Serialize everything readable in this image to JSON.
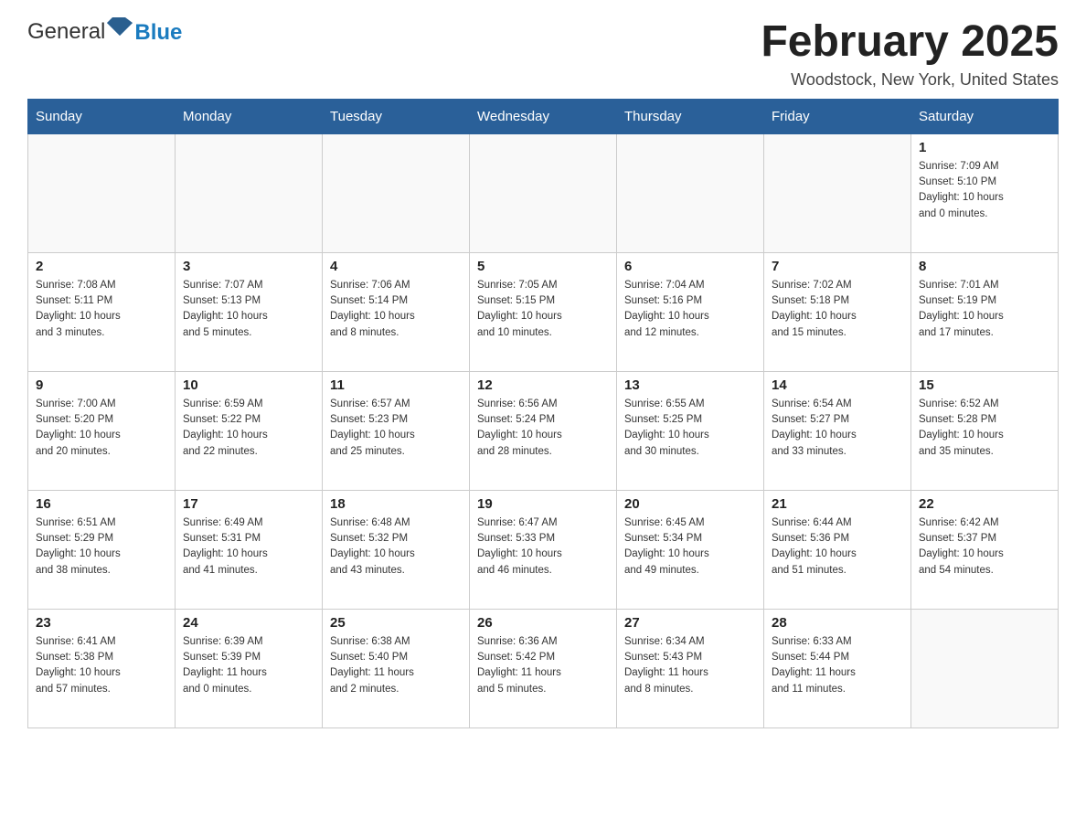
{
  "header": {
    "logo_general": "General",
    "logo_blue": "Blue",
    "month_title": "February 2025",
    "location": "Woodstock, New York, United States"
  },
  "weekdays": [
    "Sunday",
    "Monday",
    "Tuesday",
    "Wednesday",
    "Thursday",
    "Friday",
    "Saturday"
  ],
  "weeks": [
    [
      {
        "day": "",
        "info": ""
      },
      {
        "day": "",
        "info": ""
      },
      {
        "day": "",
        "info": ""
      },
      {
        "day": "",
        "info": ""
      },
      {
        "day": "",
        "info": ""
      },
      {
        "day": "",
        "info": ""
      },
      {
        "day": "1",
        "info": "Sunrise: 7:09 AM\nSunset: 5:10 PM\nDaylight: 10 hours\nand 0 minutes."
      }
    ],
    [
      {
        "day": "2",
        "info": "Sunrise: 7:08 AM\nSunset: 5:11 PM\nDaylight: 10 hours\nand 3 minutes."
      },
      {
        "day": "3",
        "info": "Sunrise: 7:07 AM\nSunset: 5:13 PM\nDaylight: 10 hours\nand 5 minutes."
      },
      {
        "day": "4",
        "info": "Sunrise: 7:06 AM\nSunset: 5:14 PM\nDaylight: 10 hours\nand 8 minutes."
      },
      {
        "day": "5",
        "info": "Sunrise: 7:05 AM\nSunset: 5:15 PM\nDaylight: 10 hours\nand 10 minutes."
      },
      {
        "day": "6",
        "info": "Sunrise: 7:04 AM\nSunset: 5:16 PM\nDaylight: 10 hours\nand 12 minutes."
      },
      {
        "day": "7",
        "info": "Sunrise: 7:02 AM\nSunset: 5:18 PM\nDaylight: 10 hours\nand 15 minutes."
      },
      {
        "day": "8",
        "info": "Sunrise: 7:01 AM\nSunset: 5:19 PM\nDaylight: 10 hours\nand 17 minutes."
      }
    ],
    [
      {
        "day": "9",
        "info": "Sunrise: 7:00 AM\nSunset: 5:20 PM\nDaylight: 10 hours\nand 20 minutes."
      },
      {
        "day": "10",
        "info": "Sunrise: 6:59 AM\nSunset: 5:22 PM\nDaylight: 10 hours\nand 22 minutes."
      },
      {
        "day": "11",
        "info": "Sunrise: 6:57 AM\nSunset: 5:23 PM\nDaylight: 10 hours\nand 25 minutes."
      },
      {
        "day": "12",
        "info": "Sunrise: 6:56 AM\nSunset: 5:24 PM\nDaylight: 10 hours\nand 28 minutes."
      },
      {
        "day": "13",
        "info": "Sunrise: 6:55 AM\nSunset: 5:25 PM\nDaylight: 10 hours\nand 30 minutes."
      },
      {
        "day": "14",
        "info": "Sunrise: 6:54 AM\nSunset: 5:27 PM\nDaylight: 10 hours\nand 33 minutes."
      },
      {
        "day": "15",
        "info": "Sunrise: 6:52 AM\nSunset: 5:28 PM\nDaylight: 10 hours\nand 35 minutes."
      }
    ],
    [
      {
        "day": "16",
        "info": "Sunrise: 6:51 AM\nSunset: 5:29 PM\nDaylight: 10 hours\nand 38 minutes."
      },
      {
        "day": "17",
        "info": "Sunrise: 6:49 AM\nSunset: 5:31 PM\nDaylight: 10 hours\nand 41 minutes."
      },
      {
        "day": "18",
        "info": "Sunrise: 6:48 AM\nSunset: 5:32 PM\nDaylight: 10 hours\nand 43 minutes."
      },
      {
        "day": "19",
        "info": "Sunrise: 6:47 AM\nSunset: 5:33 PM\nDaylight: 10 hours\nand 46 minutes."
      },
      {
        "day": "20",
        "info": "Sunrise: 6:45 AM\nSunset: 5:34 PM\nDaylight: 10 hours\nand 49 minutes."
      },
      {
        "day": "21",
        "info": "Sunrise: 6:44 AM\nSunset: 5:36 PM\nDaylight: 10 hours\nand 51 minutes."
      },
      {
        "day": "22",
        "info": "Sunrise: 6:42 AM\nSunset: 5:37 PM\nDaylight: 10 hours\nand 54 minutes."
      }
    ],
    [
      {
        "day": "23",
        "info": "Sunrise: 6:41 AM\nSunset: 5:38 PM\nDaylight: 10 hours\nand 57 minutes."
      },
      {
        "day": "24",
        "info": "Sunrise: 6:39 AM\nSunset: 5:39 PM\nDaylight: 11 hours\nand 0 minutes."
      },
      {
        "day": "25",
        "info": "Sunrise: 6:38 AM\nSunset: 5:40 PM\nDaylight: 11 hours\nand 2 minutes."
      },
      {
        "day": "26",
        "info": "Sunrise: 6:36 AM\nSunset: 5:42 PM\nDaylight: 11 hours\nand 5 minutes."
      },
      {
        "day": "27",
        "info": "Sunrise: 6:34 AM\nSunset: 5:43 PM\nDaylight: 11 hours\nand 8 minutes."
      },
      {
        "day": "28",
        "info": "Sunrise: 6:33 AM\nSunset: 5:44 PM\nDaylight: 11 hours\nand 11 minutes."
      },
      {
        "day": "",
        "info": ""
      }
    ]
  ]
}
